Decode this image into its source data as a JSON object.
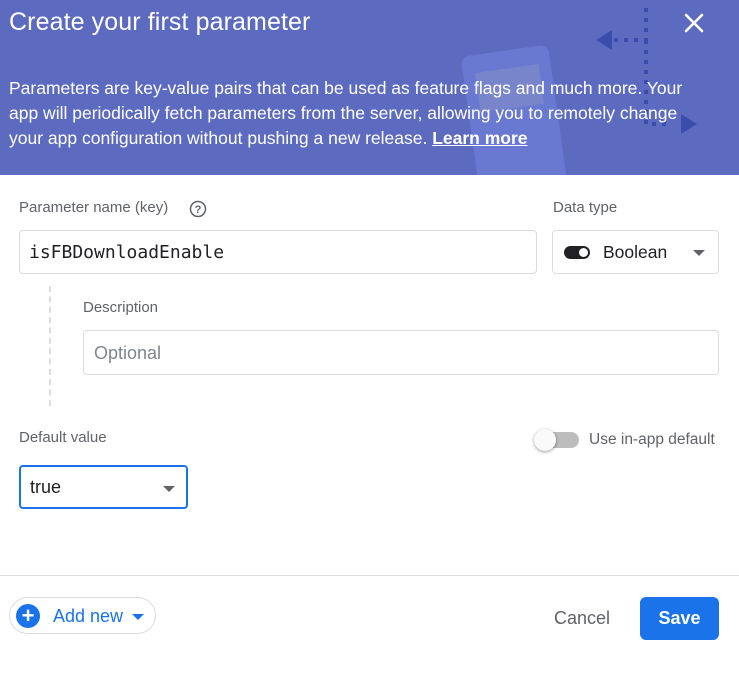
{
  "dialog": {
    "title": "Create your first parameter",
    "description": "Parameters are key-value pairs that can be used as feature flags and much more. Your app will periodically fetch parameters from the server, allowing you to remotely change your app configuration without pushing a new release.",
    "learn_more": "Learn more",
    "close_icon": "close-icon"
  },
  "form": {
    "param_name_label": "Parameter name (key)",
    "param_name_value": "isFBDownloadEnable",
    "help_icon": "help-circle-icon",
    "data_type_label": "Data type",
    "data_type_value": "Boolean",
    "description_label": "Description",
    "description_placeholder": "Optional",
    "default_value_label": "Default value",
    "default_value": "true",
    "use_in_app_default_label": "Use in-app default",
    "use_in_app_default_on": false
  },
  "footer": {
    "add_new_label": "Add new",
    "cancel_label": "Cancel",
    "save_label": "Save"
  },
  "colors": {
    "header_bg": "#5c6bc0",
    "primary": "#1a73e8"
  }
}
